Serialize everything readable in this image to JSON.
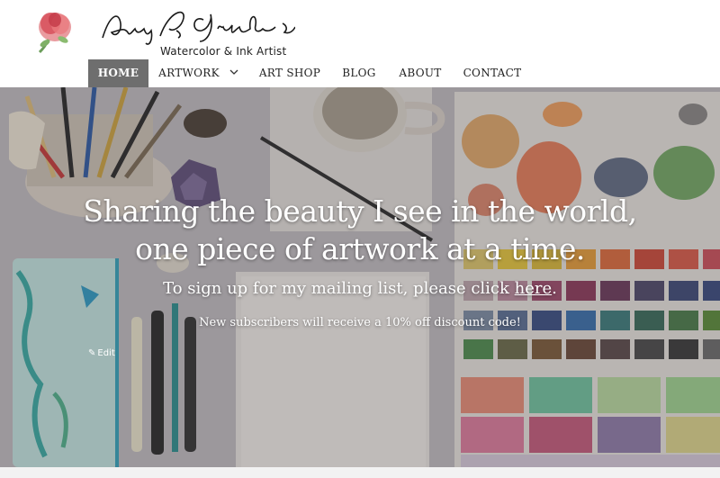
{
  "brand": {
    "signature": "Amy L Siglin",
    "tagline": "Watercolor & Ink Artist"
  },
  "nav": {
    "items": [
      {
        "label": "HOME",
        "active": true
      },
      {
        "label": "ARTWORK",
        "has_dropdown": true
      },
      {
        "label": "ART SHOP"
      },
      {
        "label": "BLOG"
      },
      {
        "label": "ABOUT"
      },
      {
        "label": "CONTACT"
      }
    ]
  },
  "hero": {
    "heading_line1": "Sharing the beauty I see in the world,",
    "heading_line2": "one piece of artwork at a time.",
    "signup_text": "To sign up for my mailing list, please click ",
    "signup_link": "here",
    "signup_end": ".",
    "subtext": "New subscribers will receive a 10% off discount code!",
    "edit_label": "Edit"
  },
  "colors": {
    "nav_active_bg": "#6e6e6e",
    "nav_text": "#222222",
    "hero_text": "#ffffff"
  },
  "icons": {
    "logo": "rose-watercolor-icon",
    "dropdown": "chevron-down-icon",
    "edit": "pencil-icon"
  }
}
